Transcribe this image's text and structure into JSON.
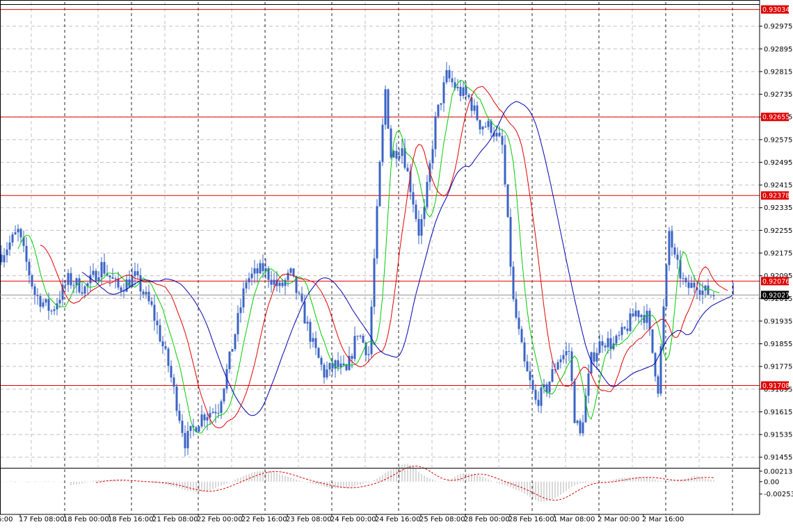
{
  "chart_data": {
    "type": "candlestick",
    "colors": {
      "background": "#ffffff",
      "grid": "#c0c0c0",
      "bars": "#3a63c4",
      "ma_fast": "#00cc00",
      "ma_mid": "#e00000",
      "ma_slow": "#0000b0",
      "levels": "#e00000",
      "osc_histogram": "#b0b0b0",
      "osc_signal": "#e00000",
      "current_tag": "#000000"
    },
    "price_axis": {
      "ticks": [
        "0.92975",
        "0.92895",
        "0.92815",
        "0.92735",
        "0.92655",
        "0.92575",
        "0.92495",
        "0.92415",
        "0.92335",
        "0.92255",
        "0.92175",
        "0.92095",
        "0.92015",
        "0.91935",
        "0.91855",
        "0.91775",
        "0.91695",
        "0.91615",
        "0.91535",
        "0.91455"
      ],
      "ylim": [
        0.9142,
        0.9306
      ]
    },
    "levels": [
      {
        "label": "0.93034",
        "value": 0.93034
      },
      {
        "label": "0.92655",
        "value": 0.92655
      },
      {
        "label": "0.92378",
        "value": 0.92378
      },
      {
        "label": "0.92076",
        "value": 0.92076
      },
      {
        "label": "0.91708",
        "value": 0.91708
      }
    ],
    "current_price": {
      "label": "0.92027",
      "value": 0.92027
    },
    "time_axis": {
      "labels": [
        "6:00",
        "17 Feb 08:00",
        "18 Feb 00:00",
        "18 Feb 16:00",
        "21 Feb 08:00",
        "22 Feb 00:00",
        "22 Feb 16:00",
        "23 Feb 08:00",
        "24 Feb 00:00",
        "24 Feb 16:00",
        "25 Feb 08:00",
        "28 Feb 00:00",
        "28 Feb 16:00",
        "1 Mar 08:00",
        "2 Mar 00:00",
        "2 Mar 16:00"
      ]
    },
    "anchors": [
      [
        0,
        0.9217
      ],
      [
        6,
        0.9225
      ],
      [
        12,
        0.9203
      ],
      [
        18,
        0.9197
      ],
      [
        24,
        0.9208
      ],
      [
        30,
        0.9205
      ],
      [
        36,
        0.9213
      ],
      [
        42,
        0.9205
      ],
      [
        48,
        0.9209
      ],
      [
        54,
        0.9198
      ],
      [
        60,
        0.9178
      ],
      [
        64,
        0.916
      ],
      [
        66,
        0.9151
      ],
      [
        72,
        0.916
      ],
      [
        78,
        0.9163
      ],
      [
        82,
        0.918
      ],
      [
        88,
        0.9208
      ],
      [
        94,
        0.9212
      ],
      [
        100,
        0.9205
      ],
      [
        104,
        0.921
      ],
      [
        108,
        0.9198
      ],
      [
        112,
        0.9185
      ],
      [
        116,
        0.9175
      ],
      [
        120,
        0.9178
      ],
      [
        124,
        0.9175
      ],
      [
        128,
        0.919
      ],
      [
        132,
        0.9182
      ],
      [
        136,
        0.9248
      ],
      [
        138,
        0.9275
      ],
      [
        140,
        0.9252
      ],
      [
        144,
        0.9255
      ],
      [
        148,
        0.9236
      ],
      [
        150,
        0.9225
      ],
      [
        152,
        0.9232
      ],
      [
        156,
        0.9264
      ],
      [
        160,
        0.928
      ],
      [
        164,
        0.9275
      ],
      [
        168,
        0.9272
      ],
      [
        172,
        0.9263
      ],
      [
        176,
        0.9262
      ],
      [
        180,
        0.9255
      ],
      [
        184,
        0.92
      ],
      [
        188,
        0.9178
      ],
      [
        192,
        0.9165
      ],
      [
        196,
        0.917
      ],
      [
        200,
        0.918
      ],
      [
        204,
        0.9183
      ],
      [
        206,
        0.916
      ],
      [
        208,
        0.9153
      ],
      [
        212,
        0.918
      ],
      [
        216,
        0.9187
      ],
      [
        220,
        0.9185
      ],
      [
        224,
        0.919
      ],
      [
        228,
        0.9197
      ],
      [
        232,
        0.9195
      ],
      [
        236,
        0.917
      ],
      [
        240,
        0.9225
      ],
      [
        242,
        0.9215
      ],
      [
        246,
        0.9205
      ],
      [
        250,
        0.9207
      ],
      [
        252,
        0.9204
      ],
      [
        256,
        0.9203
      ]
    ],
    "bar_count": 257,
    "ma_periods": {
      "fast": 5,
      "mid": 10,
      "slow": 20
    },
    "oscillator": {
      "ticks": [
        "0.002137",
        "0.00",
        "-0.002537"
      ],
      "ylim": [
        -0.003,
        0.0024
      ]
    }
  }
}
